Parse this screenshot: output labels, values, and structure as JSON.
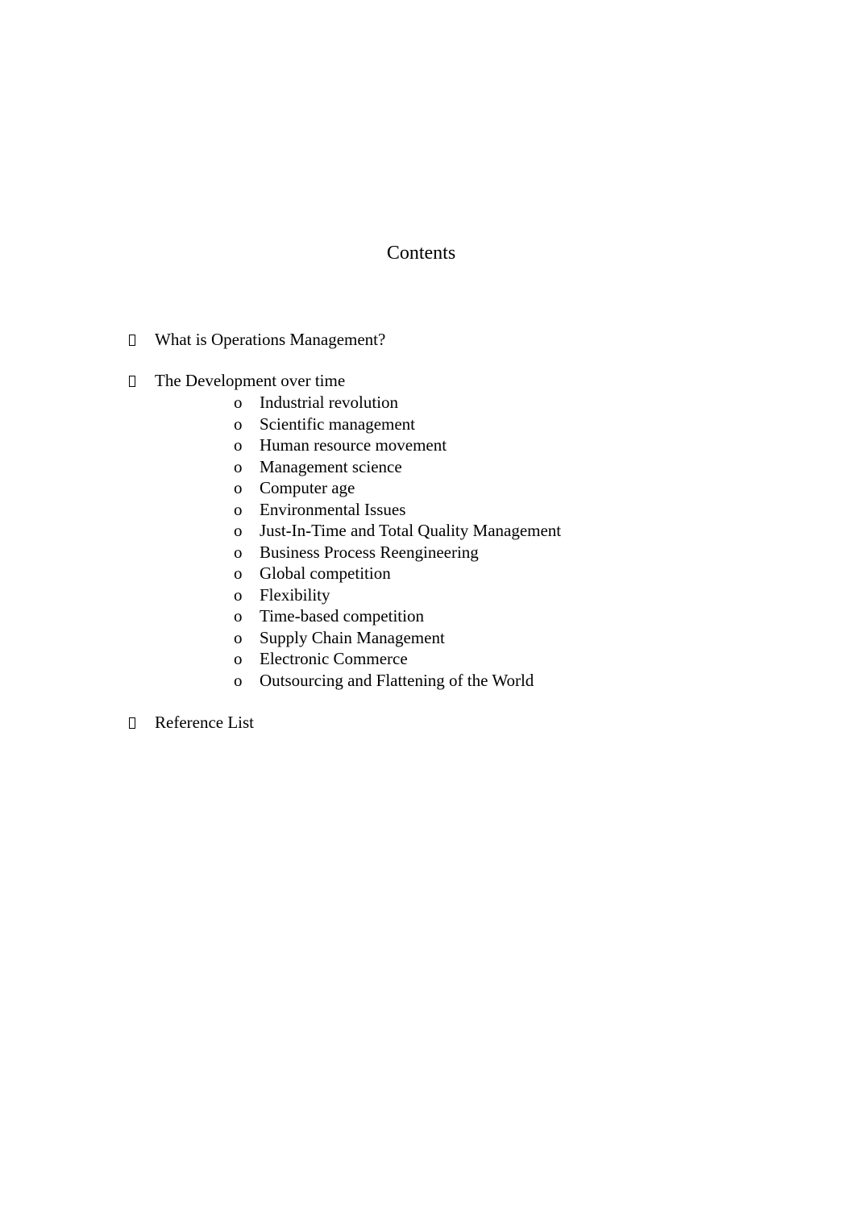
{
  "document": {
    "title": "Contents",
    "sections": [
      {
        "label": "What is Operations Management?",
        "bullet_icon": "missing-glyph-box"
      },
      {
        "label": "The Development over time",
        "bullet_icon": "missing-glyph-box",
        "subitem_bullet": "o",
        "subitems": [
          "Industrial revolution",
          "Scientific management",
          "Human resource movement",
          "Management science",
          "Computer age",
          "Environmental Issues",
          "Just-In-Time and Total Quality Management",
          "Business Process Reengineering",
          "Global competition",
          "Flexibility",
          "Time-based competition",
          "Supply Chain Management",
          "Electronic Commerce",
          "Outsourcing and Flattening of the World"
        ]
      },
      {
        "label": "Reference List",
        "bullet_icon": "missing-glyph-box"
      }
    ]
  }
}
